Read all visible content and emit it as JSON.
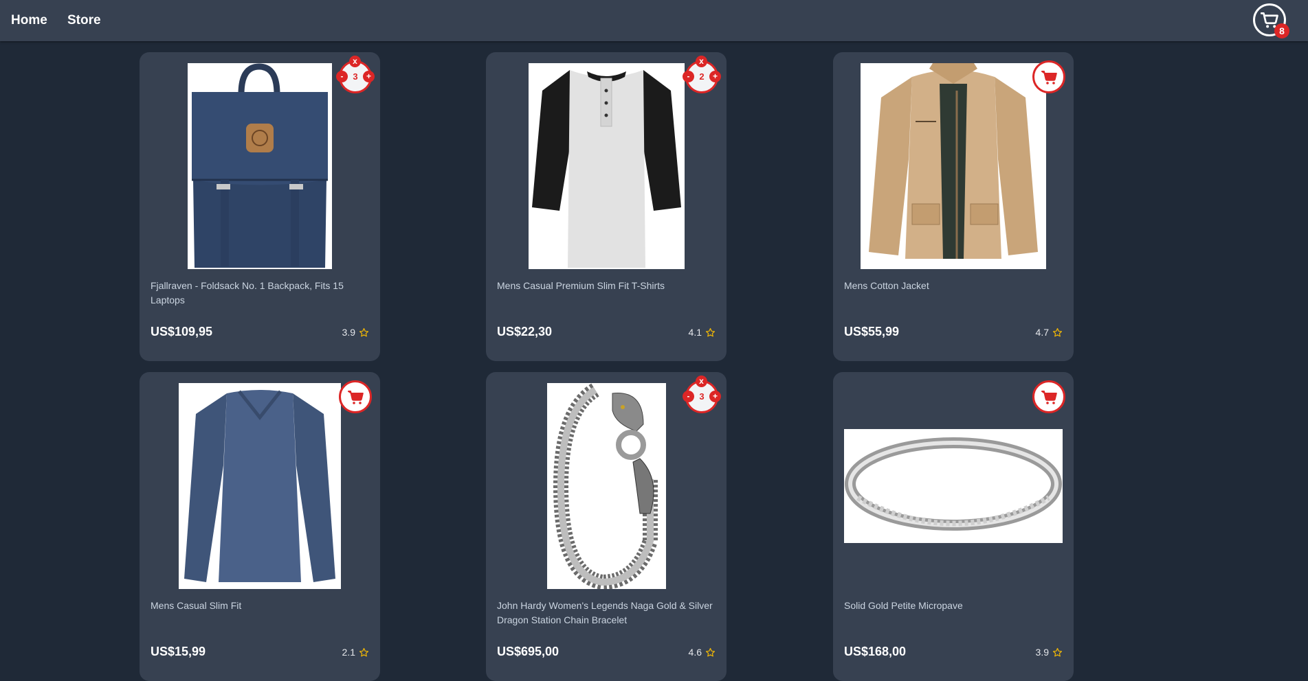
{
  "nav": {
    "home_label": "Home",
    "store_label": "Store",
    "cart_count": "8"
  },
  "colors": {
    "accent": "#dc2626",
    "star": "#eab308",
    "card": "#374151",
    "background": "#1f2937"
  },
  "qty_buttons": {
    "remove": "x",
    "minus": "-",
    "plus": "+"
  },
  "products": [
    {
      "title": "Fjallraven - Foldsack No. 1 Backpack, Fits 15 Laptops",
      "price": "US$109,95",
      "rating": "3.9",
      "quantity": "3",
      "image": "navy-backpack"
    },
    {
      "title": "Mens Casual Premium Slim Fit T-Shirts",
      "price": "US$22,30",
      "rating": "4.1",
      "quantity": "2",
      "image": "raglan-henley-shirt"
    },
    {
      "title": "Mens Cotton Jacket",
      "price": "US$55,99",
      "rating": "4.7",
      "quantity": null,
      "image": "khaki-jacket"
    },
    {
      "title": "Mens Casual Slim Fit",
      "price": "US$15,99",
      "rating": "2.1",
      "quantity": null,
      "image": "blue-long-sleeve-shirt"
    },
    {
      "title": "John Hardy Women's Legends Naga Gold & Silver Dragon Station Chain Bracelet",
      "price": "US$695,00",
      "rating": "4.6",
      "quantity": "3",
      "image": "dragon-bracelet"
    },
    {
      "title": "Solid Gold Petite Micropave",
      "price": "US$168,00",
      "rating": "3.9",
      "quantity": null,
      "image": "silver-ring"
    }
  ]
}
